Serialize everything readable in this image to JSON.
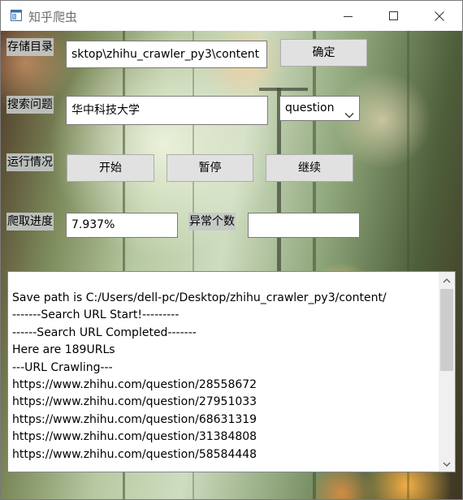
{
  "window": {
    "title": "知乎爬虫"
  },
  "form": {
    "storage_label": "存储目录",
    "storage_path": "sktop\\zhihu_crawler_py3\\content",
    "confirm_label": "确定",
    "search_label": "搜索问题",
    "search_query": "华中科技大学",
    "search_type_selected": "question",
    "status_label": "运行情况",
    "start_label": "开始",
    "pause_label": "暂停",
    "resume_label": "继续",
    "progress_label": "爬取进度",
    "progress_value": "7.937%",
    "error_count_label": "异常个数",
    "error_count_value": ""
  },
  "log": {
    "lines": [
      "Save path is C:/Users/dell-pc/Desktop/zhihu_crawler_py3/content/",
      "-------Search URL Start!---------",
      "------Search URL Completed-------",
      "Here are 189URLs",
      "---URL Crawling---",
      "https://www.zhihu.com/question/28558672",
      "https://www.zhihu.com/question/27951033",
      "https://www.zhihu.com/question/68631319",
      "https://www.zhihu.com/question/31384808",
      "https://www.zhihu.com/question/58584448"
    ]
  },
  "icons": {
    "app": "app-window-icon",
    "minimize": "minimize-icon",
    "maximize": "maximize-icon",
    "close": "close-icon",
    "dropdown": "chevron-down-icon",
    "scroll_up": "scroll-up-arrow-icon",
    "scroll_down": "scroll-down-arrow-icon"
  }
}
